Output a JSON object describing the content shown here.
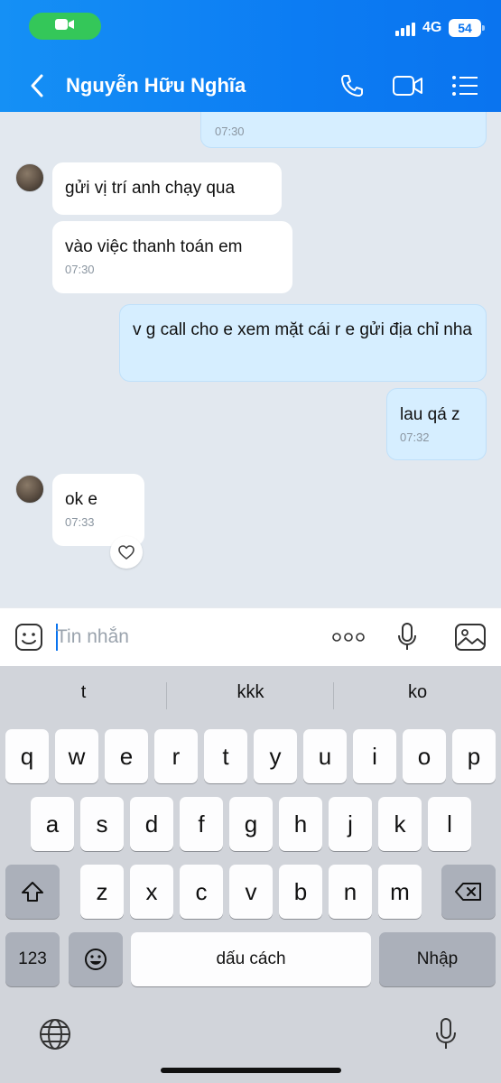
{
  "status_bar": {
    "network": "4G",
    "battery": "54"
  },
  "header": {
    "contact_name": "Nguyễn Hữu Nghĩa"
  },
  "messages": [
    {
      "side": "out",
      "text": "",
      "time": "07:30"
    },
    {
      "side": "in",
      "text": "gửi vị trí anh chạy qua",
      "time": ""
    },
    {
      "side": "in",
      "text": "vào việc thanh toán em",
      "time": "07:30"
    },
    {
      "side": "out",
      "text": "v g call cho e xem mặt cái r e gửi địa chỉ nha",
      "time": ""
    },
    {
      "side": "out",
      "text": "lau qá z",
      "time": "07:32"
    },
    {
      "side": "in",
      "text": "ok e",
      "time": "07:33"
    }
  ],
  "composer": {
    "placeholder": "Tin nhắn",
    "value": ""
  },
  "keyboard": {
    "suggestions": [
      "t",
      "kkk",
      "ko"
    ],
    "row1": [
      "q",
      "w",
      "e",
      "r",
      "t",
      "y",
      "u",
      "i",
      "o",
      "p"
    ],
    "row2": [
      "a",
      "s",
      "d",
      "f",
      "g",
      "h",
      "j",
      "k",
      "l"
    ],
    "row3": [
      "z",
      "x",
      "c",
      "v",
      "b",
      "n",
      "m"
    ],
    "numbers_key": "123",
    "space_key": "dấu cách",
    "return_key": "Nhập"
  },
  "colors": {
    "header": "#0a74ef",
    "outgoing_bubble": "#d6eeff",
    "incoming_bubble": "#ffffff",
    "call_pill": "#34c759"
  }
}
